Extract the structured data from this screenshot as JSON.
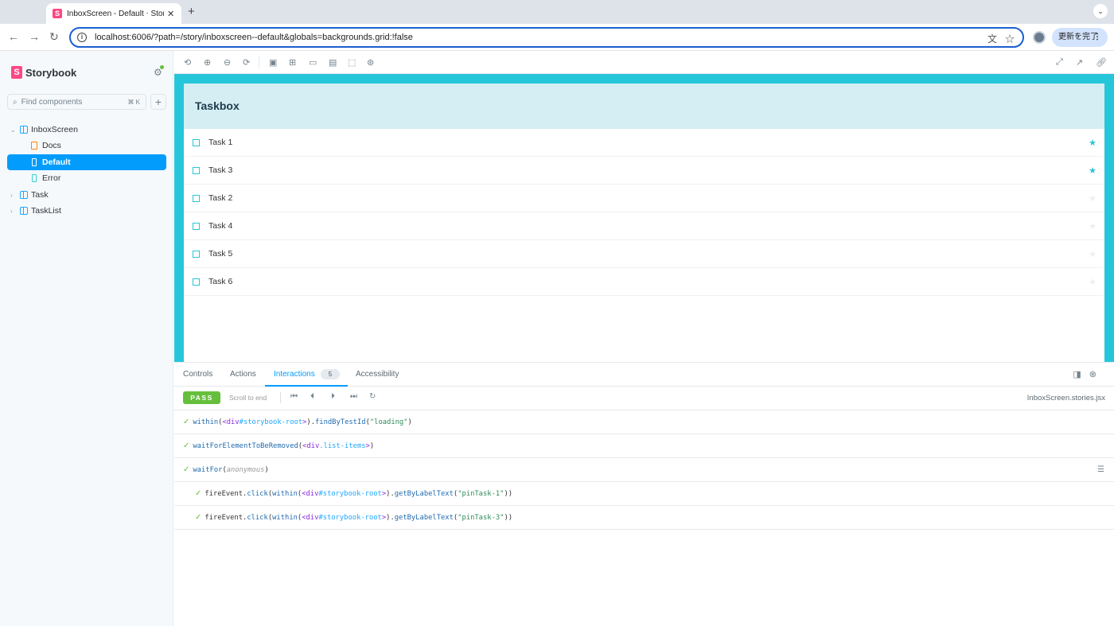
{
  "browser": {
    "tab_title": "InboxScreen - Default ⋅ Storybook",
    "tab_close": "✕",
    "new_tab": "+",
    "url": "localhost:6006/?path=/story/inboxscreen--default&globals=backgrounds.grid:!false",
    "update_button": "更新を完了",
    "icons": [
      "back-icon",
      "forward-icon",
      "reload-icon",
      "info-icon",
      "translate-icon",
      "bookmark-star-icon",
      "profile-avatar",
      "menu-kebab-icon"
    ]
  },
  "sidebar": {
    "logo_text": "Storybook",
    "search_placeholder": "Find components",
    "search_shortcut": "⌘ K",
    "tree": [
      {
        "label": "InboxScreen",
        "type": "component",
        "expanded": true
      },
      {
        "label": "Docs",
        "type": "docs"
      },
      {
        "label": "Default",
        "type": "story",
        "selected": true
      },
      {
        "label": "Error",
        "type": "story"
      },
      {
        "label": "Task",
        "type": "component",
        "expanded": false
      },
      {
        "label": "TaskList",
        "type": "component",
        "expanded": false
      }
    ]
  },
  "app": {
    "title": "Taskbox",
    "tasks": [
      {
        "label": "Task 1",
        "pinned": true
      },
      {
        "label": "Task 3",
        "pinned": true
      },
      {
        "label": "Task 2",
        "pinned": false
      },
      {
        "label": "Task 4",
        "pinned": false
      },
      {
        "label": "Task 5",
        "pinned": false
      },
      {
        "label": "Task 6",
        "pinned": false
      }
    ]
  },
  "colors": {
    "accent": "#26c6da",
    "pinned_star": "#26c6da",
    "unpinned_star": "#eeeeee",
    "storybook_blue": "#029cfd",
    "pass_green": "#66bf3c"
  },
  "panel": {
    "tabs": [
      "Controls",
      "Actions",
      "Interactions",
      "Accessibility"
    ],
    "active_tab": "Interactions",
    "interactions_count": "5",
    "status": "PASS",
    "scroll_to_end": "Scroll to end",
    "file_name": "InboxScreen.stories.jsx",
    "steps": [
      {
        "indent": 0,
        "tokens": [
          [
            "fn",
            "within"
          ],
          [
            "pl",
            "("
          ],
          [
            "el",
            "<div"
          ],
          [
            "sel2",
            "#storybook-root"
          ],
          [
            "el",
            ">"
          ],
          [
            "pl",
            ")."
          ],
          [
            "fn",
            "findByTestId"
          ],
          [
            "pl",
            "("
          ],
          [
            "str",
            "\"loading\""
          ],
          [
            "pl",
            ")"
          ]
        ]
      },
      {
        "indent": 0,
        "tokens": [
          [
            "fn",
            "waitForElementToBeRemoved"
          ],
          [
            "pl",
            "("
          ],
          [
            "el",
            "<div"
          ],
          [
            "sel2",
            ".list-items"
          ],
          [
            "el",
            ">"
          ],
          [
            "pl",
            ")"
          ]
        ]
      },
      {
        "indent": 0,
        "tokens": [
          [
            "fn",
            "waitFor"
          ],
          [
            "pl",
            "("
          ],
          [
            "ano",
            "anonymous"
          ],
          [
            "pl",
            ")"
          ]
        ]
      },
      {
        "indent": 1,
        "tokens": [
          [
            "pl",
            "fireEvent."
          ],
          [
            "fn",
            "click"
          ],
          [
            "pl",
            "("
          ],
          [
            "fn",
            "within"
          ],
          [
            "pl",
            "("
          ],
          [
            "el",
            "<div"
          ],
          [
            "sel2",
            "#storybook-root"
          ],
          [
            "el",
            ">"
          ],
          [
            "pl",
            ")."
          ],
          [
            "fn",
            "getByLabelText"
          ],
          [
            "pl",
            "("
          ],
          [
            "str",
            "\"pinTask-1\""
          ],
          [
            "pl",
            "))"
          ]
        ]
      },
      {
        "indent": 1,
        "tokens": [
          [
            "pl",
            "fireEvent."
          ],
          [
            "fn",
            "click"
          ],
          [
            "pl",
            "("
          ],
          [
            "fn",
            "within"
          ],
          [
            "pl",
            "("
          ],
          [
            "el",
            "<div"
          ],
          [
            "sel2",
            "#storybook-root"
          ],
          [
            "el",
            ">"
          ],
          [
            "pl",
            ")."
          ],
          [
            "fn",
            "getByLabelText"
          ],
          [
            "pl",
            "("
          ],
          [
            "str",
            "\"pinTask-3\""
          ],
          [
            "pl",
            "))"
          ]
        ]
      }
    ]
  }
}
